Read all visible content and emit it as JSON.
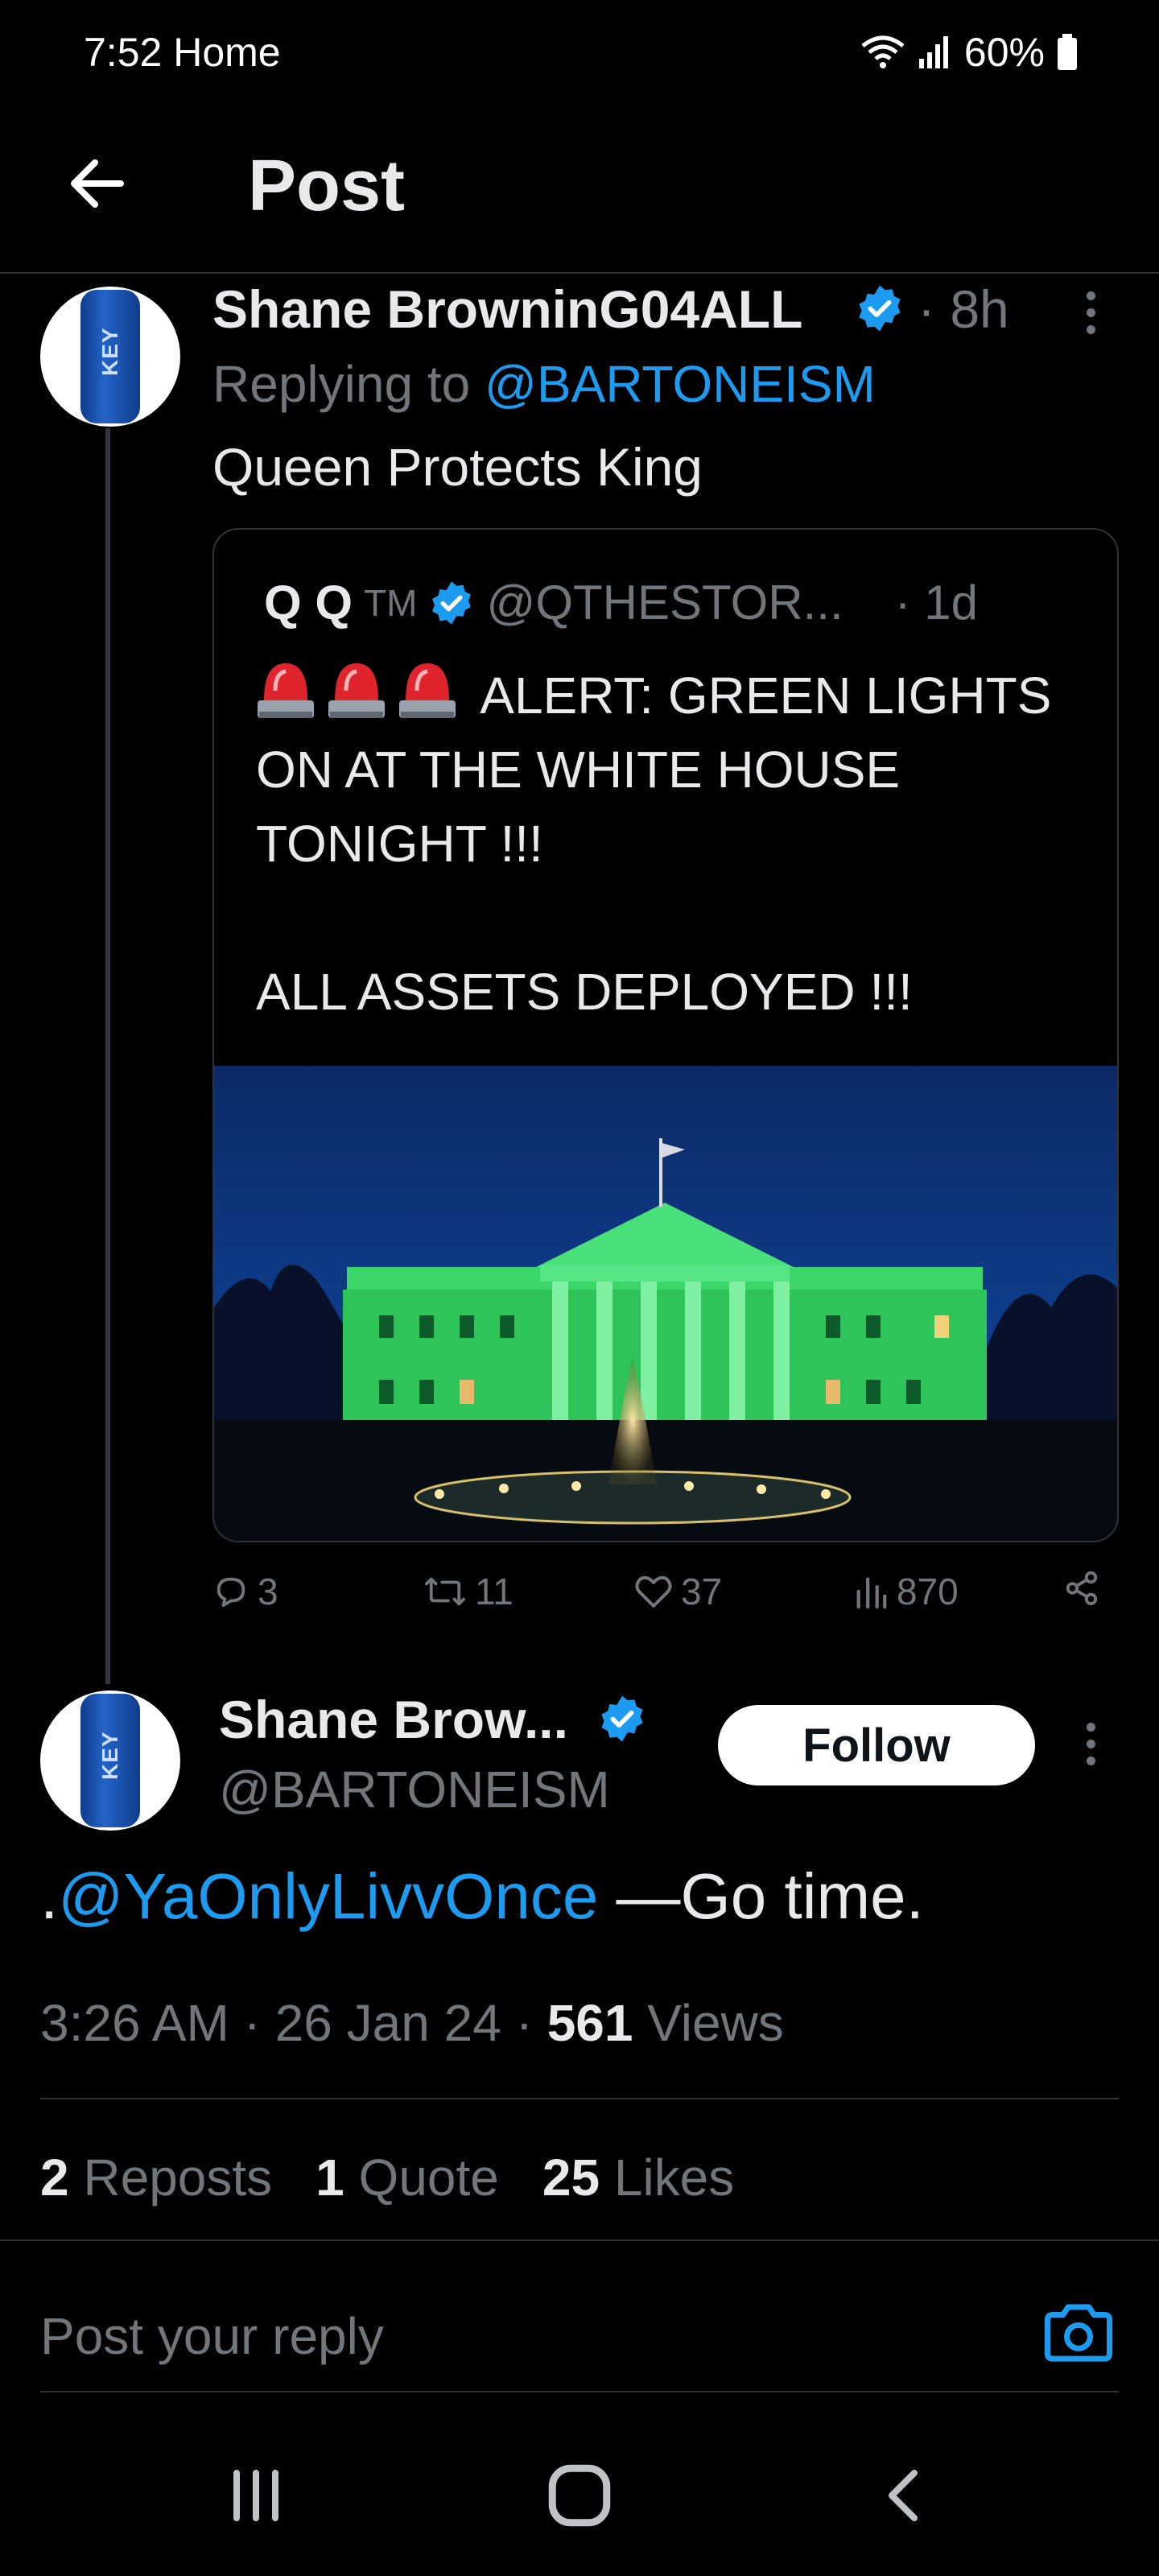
{
  "status_bar": {
    "time": "7:52 Home",
    "battery": "60%"
  },
  "header": {
    "title": "Post"
  },
  "reply_post": {
    "author_name": "Shane BrowninG04ALL",
    "time": "· 8h",
    "replying_prefix": "Replying to",
    "replying_handle": "@BARTONEISM",
    "text": "Queen Protects King",
    "quoted": {
      "name": "Q Q",
      "tm": "TM",
      "handle": "@QTHESTOR...",
      "time": "· 1d",
      "line1": "ALERT: GREEN LIGHTS",
      "line2": "ON AT THE WHITE HOUSE",
      "line3": "TONIGHT !!!",
      "line4": "ALL ASSETS DEPLOYED !!!"
    },
    "actions": {
      "replies": "3",
      "reposts": "11",
      "likes": "37",
      "views": "870"
    }
  },
  "main_post": {
    "author_name": "Shane Brow...",
    "handle": "@BARTONEISM",
    "follow_label": "Follow",
    "text_prefix": ".",
    "mention": "@YaOnlyLivvOnce",
    "text_rest": " —Go time.",
    "time": "3:26 AM",
    "date": "26 Jan 24",
    "views_count": "561",
    "views_label": "Views",
    "reposts_count": "2",
    "reposts_label": "Reposts",
    "quotes_count": "1",
    "quotes_label": "Quote",
    "likes_count": "25",
    "likes_label": "Likes"
  },
  "reply_box": {
    "placeholder": "Post your reply"
  },
  "colors": {
    "accent": "#1d9bf0",
    "background": "#000000",
    "muted": "#71767b"
  }
}
